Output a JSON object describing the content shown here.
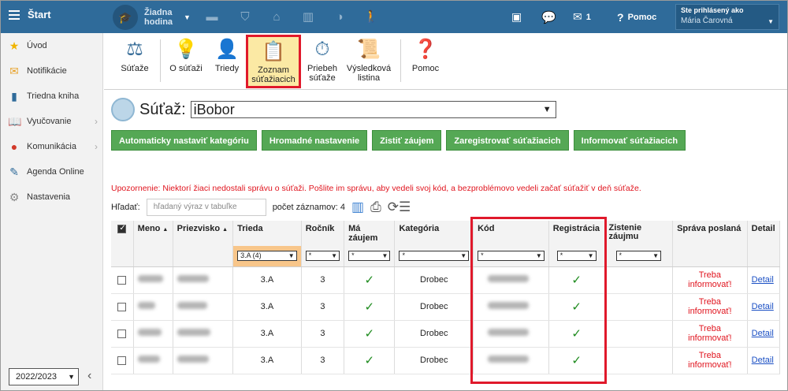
{
  "topbar": {
    "home_label": "Štart",
    "hour_label": "Žiadna hodina",
    "notify_count": "1",
    "help_label": "Pomoc",
    "user_caption": "Ste prihlásený ako",
    "user_name": "Mária Čarovná",
    "modules": [
      "cap-icon",
      "briefcase-icon",
      "shield-icon",
      "bank-icon",
      "chart-icon",
      "palette-icon",
      "walker-icon"
    ]
  },
  "sidebar": {
    "items": [
      {
        "label": "Úvod",
        "icon": "star-icon"
      },
      {
        "label": "Notifikácie",
        "icon": "envelope-icon"
      },
      {
        "label": "Triedna kniha",
        "icon": "book-icon"
      },
      {
        "label": "Vyučovanie",
        "icon": "open-book-icon"
      },
      {
        "label": "Komunikácia",
        "icon": "chat-icon"
      },
      {
        "label": "Agenda Online",
        "icon": "pen-icon"
      },
      {
        "label": "Nastavenia",
        "icon": "gear-icon"
      }
    ],
    "year": "2022/2023"
  },
  "toolbar": {
    "buttons": [
      {
        "label": "Súťaže",
        "icon": "scales-icon"
      },
      {
        "label": "O súťaži",
        "icon": "bulb-icon"
      },
      {
        "label": "Triedy",
        "icon": "person-icon"
      },
      {
        "label": "Zoznam súťažiacich",
        "icon": "clipboard-icon"
      },
      {
        "label": "Priebeh súťaže",
        "icon": "stopwatch-icon"
      },
      {
        "label": "Výsledková listina",
        "icon": "certificate-icon"
      },
      {
        "label": "Pomoc",
        "icon": "help-icon"
      }
    ]
  },
  "competition": {
    "label": "Súťaž:",
    "value": "iBobor"
  },
  "actions": [
    "Automaticky nastaviť kategóriu",
    "Hromadné nastavenie",
    "Zistiť záujem",
    "Zaregistrovať súťažiacich",
    "Informovať súťažiacich"
  ],
  "warning": "Upozornenie: Niektorí žiaci nedostali správu o súťaži. Pošlite im správu, aby vedeli svoj kód, a bezproblémovo vedeli začať súťažiť v deň súťaže.",
  "filter": {
    "label": "Hľadať:",
    "placeholder": "hľadaný výraz v tabuľke",
    "count_label": "počet záznamov: 4"
  },
  "table": {
    "headers": {
      "meno": "Meno",
      "priezvisko": "Priezvisko",
      "trieda": "Trieda",
      "rocnik": "Ročník",
      "ma_zaujem": "Má záujem",
      "kategoria": "Kategória",
      "kod": "Kód",
      "registracia": "Registrácia",
      "zistenie": "Zistenie záujmu",
      "sprava": "Správa poslaná",
      "detail": "Detail"
    },
    "filters": {
      "trieda": "3.A (4)",
      "any": "*"
    },
    "rows": [
      {
        "trieda": "3.A",
        "rocnik": "3",
        "kategoria": "Drobec",
        "sprava": "Treba informovať!",
        "detail": "Detail"
      },
      {
        "trieda": "3.A",
        "rocnik": "3",
        "kategoria": "Drobec",
        "sprava": "Treba informovať!",
        "detail": "Detail"
      },
      {
        "trieda": "3.A",
        "rocnik": "3",
        "kategoria": "Drobec",
        "sprava": "Treba informovať!",
        "detail": "Detail"
      },
      {
        "trieda": "3.A",
        "rocnik": "3",
        "kategoria": "Drobec",
        "sprava": "Treba informovať!",
        "detail": "Detail"
      }
    ]
  },
  "colors": {
    "topbar": "#2f6b9a",
    "accent_red": "#e0192b",
    "action_green": "#55a855",
    "active_tool": "#fbe9a4",
    "warning_red": "#e0141e"
  }
}
